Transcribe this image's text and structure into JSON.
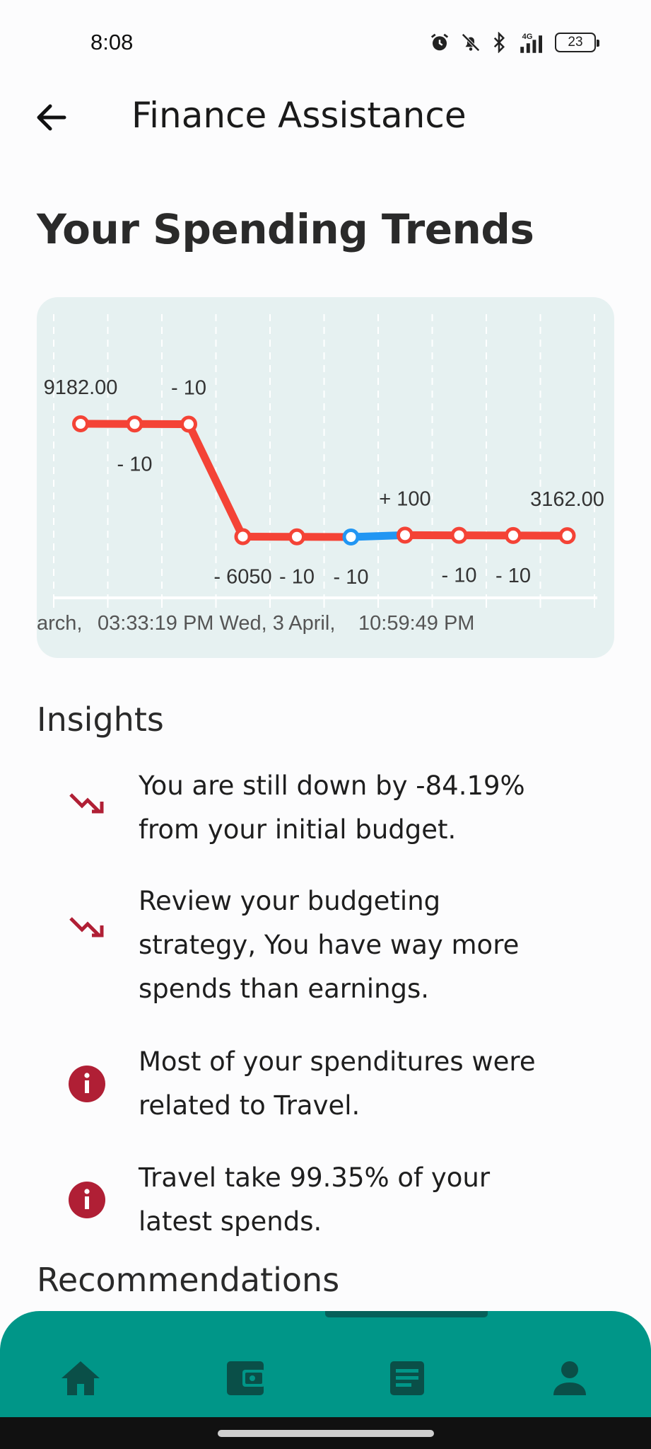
{
  "status_bar": {
    "time": "8:08",
    "battery": "23",
    "icons": [
      "alarm-icon",
      "bell-off-icon",
      "bluetooth-icon",
      "signal-4g-icon",
      "battery-icon"
    ]
  },
  "app_bar": {
    "title": "Finance Assistance",
    "back_icon": "arrow-left-icon"
  },
  "heading": "Your Spending Trends",
  "chart_data": {
    "type": "line",
    "x_tick_labels": [
      "arch,",
      "03:33:19 PM Wed, 3 April,",
      "10:59:49 PM"
    ],
    "series": [
      {
        "values": [
          9182.0,
          9172.0,
          9162.0,
          3112.0,
          3102.0,
          3092.0,
          3192.0,
          3182.0,
          3172.0,
          3162.0
        ],
        "point_labels": [
          "9182.00",
          "- 10",
          "- 10",
          "- 6050",
          "- 10",
          "- 10",
          "+ 100",
          "- 10",
          "- 10",
          "3162.00"
        ],
        "color": "#f44336",
        "highlight_color": "#2196f3"
      }
    ],
    "highlighted_segment": [
      5,
      6
    ],
    "grid": "vertical-dashed",
    "background": "#e6f1f1"
  },
  "insights": {
    "title": "Insights",
    "items": [
      {
        "icon": "trending-down-icon",
        "text_lines": [
          "You are still down by -84.19%",
          "from your initial budget."
        ]
      },
      {
        "icon": "trending-down-icon",
        "text_lines": [
          "Review your budgeting",
          "strategy, You have way more",
          "spends than earnings."
        ]
      },
      {
        "icon": "info-icon",
        "text_lines": [
          "Most of your spenditures were",
          "related to Travel."
        ]
      },
      {
        "icon": "info-icon",
        "text_lines": [
          "Travel take 99.35% of your",
          "latest spends."
        ]
      }
    ]
  },
  "recommendations": {
    "title": "Recommendations"
  },
  "bottom_nav": {
    "items": [
      "home-icon",
      "wallet-icon",
      "article-icon",
      "person-icon"
    ],
    "color": "#009688"
  }
}
